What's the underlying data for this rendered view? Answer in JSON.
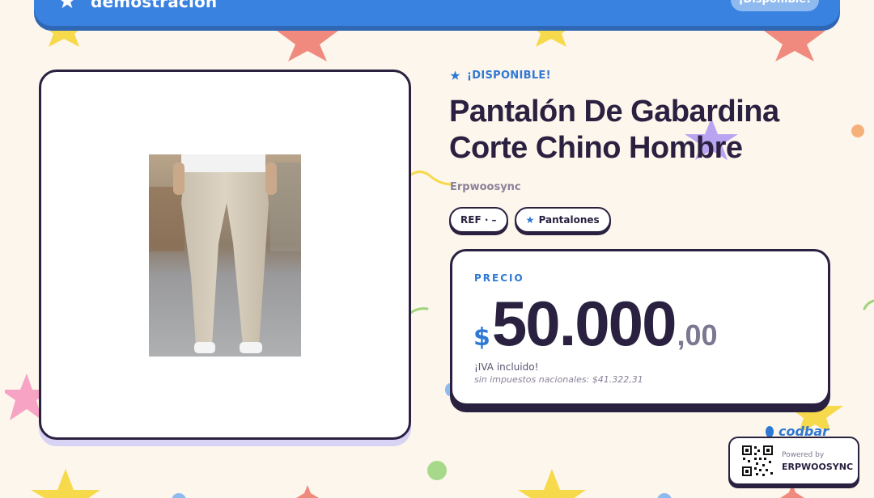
{
  "banner": {
    "title": "demostración",
    "badge": "¡Disponible!"
  },
  "colors": {
    "background": "#fdf6ec",
    "accent_blue": "#3a82e0",
    "ink": "#2a2140",
    "star_yellow": "#f7d94c",
    "star_coral": "#f08a7e",
    "star_pink": "#f7a3c4",
    "star_purple": "#b9a4f2"
  },
  "product": {
    "availability": "¡DISPONIBLE!",
    "title": "Pantalón De Gabardina Corte Chino Hombre",
    "brand": "Erpwoosync",
    "ref_chip": "REF · –",
    "category_chip": "Pantalones",
    "image_icon": "product-photo"
  },
  "price": {
    "label": "PRECIO",
    "currency": "$",
    "integer": "50.000",
    "decimals": ",00",
    "iva_note": "¡IVA incluido!",
    "tax_note": "sin impuestos nacionales: $41.322,31"
  },
  "footer": {
    "logo": "codbar",
    "powered_by": "Powered by",
    "powered_name": "ERPWOOSYNC"
  }
}
